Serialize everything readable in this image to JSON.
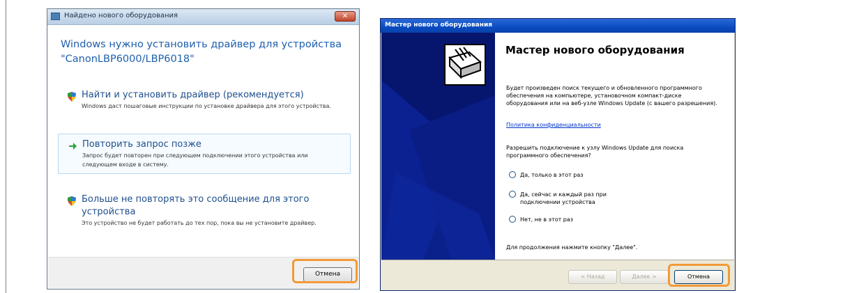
{
  "vista_dialog": {
    "title": "Найдено нового оборудования",
    "close_label": "✕",
    "heading": "Windows нужно установить драйвер для устройства \"CanonLBP6000/LBP6018\"",
    "options": [
      {
        "title": "Найти и установить драйвер (рекомендуется)",
        "description": "Windows даст пошаговые инструкции по установке драйвера для этого устройства.",
        "icon": "shield-icon"
      },
      {
        "title": "Повторить запрос позже",
        "description": "Запрос будет повторен при следующем подключении этого устройства или следующем входе в систему.",
        "icon": "arrow-right-icon"
      },
      {
        "title": "Больше не повторять это сообщение для этого устройства",
        "description": "Это устройство не будет работать до тех пор, пока вы не установите драйвер.",
        "icon": "shield-icon"
      }
    ],
    "cancel_label": "Отмена"
  },
  "xp_wizard": {
    "title": "Мастер нового оборудования",
    "heading": "Мастер нового оборудования",
    "intro": "Будет произведен поиск текущего и обновленного программного обеспечения на компьютере, установочном компакт-диске оборудования или на веб-узле Windows Update (с вашего разрешения).",
    "privacy_link": "Политика конфиденциальности",
    "question": "Разрешить подключение к узлу Windows Update для поиска программного обеспечения?",
    "radios": [
      "Да, только в этот раз",
      "Да, сейчас и каждый раз при подключении устройства",
      "Нет, не в этот раз"
    ],
    "continue_hint": "Для продолжения нажмите кнопку \"Далее\".",
    "back_label": "< Назад",
    "next_label": "Далее >",
    "cancel_label": "Отмена"
  },
  "colors": {
    "highlight": "#f39a36",
    "vista_heading": "#1e5fae",
    "xp_sidepanel": "#06166f"
  }
}
